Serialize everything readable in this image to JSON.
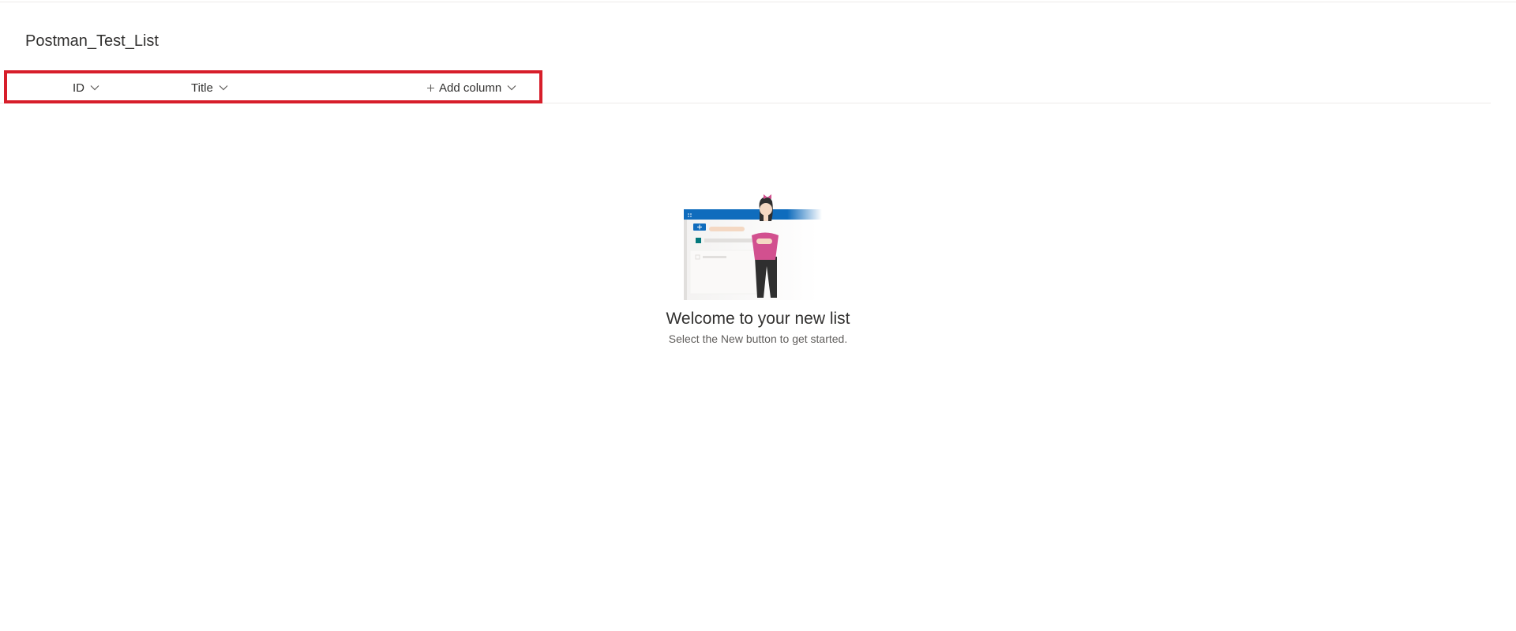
{
  "list": {
    "title": "Postman_Test_List"
  },
  "columns": [
    {
      "label": "ID"
    },
    {
      "label": "Title"
    },
    {
      "label": "Add column"
    }
  ],
  "empty_state": {
    "title": "Welcome to your new list",
    "subtitle": "Select the New button to get started."
  },
  "colors": {
    "accent": "#0f6cbd",
    "highlight": "#d71e2a",
    "figure_shirt": "#d2508f"
  },
  "icons": {
    "column_menu": "chevron-down-icon",
    "add": "plus-icon"
  }
}
